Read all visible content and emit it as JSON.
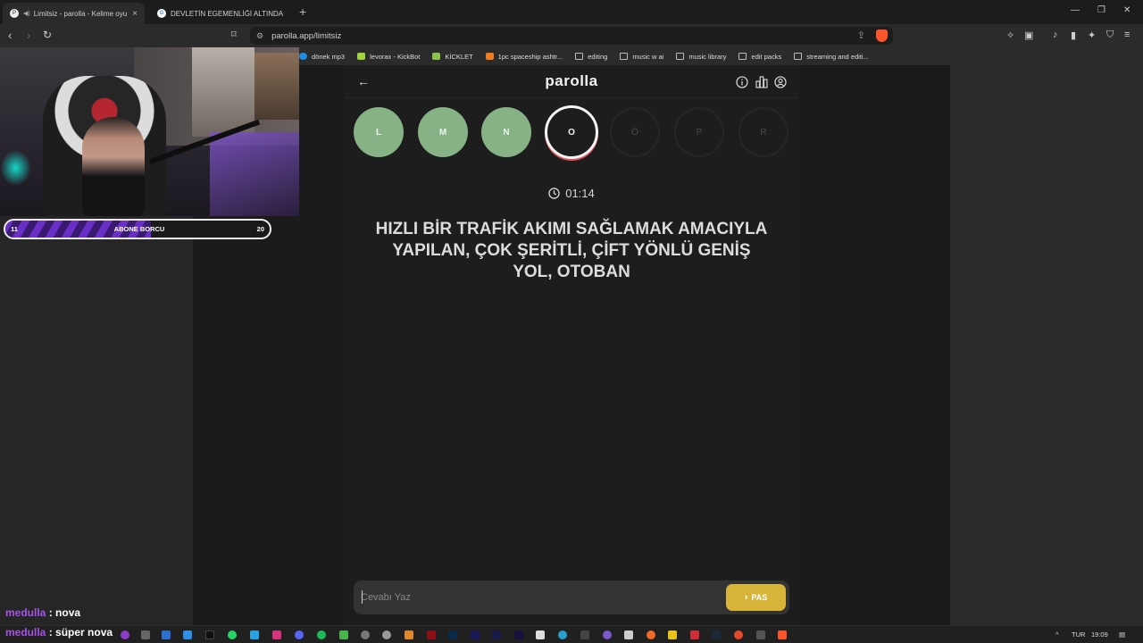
{
  "browser": {
    "tabs": [
      {
        "title": "Limitsiz - parolla - Kelime oyu",
        "active": true
      },
      {
        "title": "DEVLETİN EGEMENLİĞİ ALTINDA BU",
        "active": false
      }
    ],
    "new_tab": "+",
    "url": "parolla.app/limitsiz",
    "bookmarks": [
      {
        "label": "dönek mp3",
        "icon": "edge-icon",
        "color": "#1e8fe0"
      },
      {
        "label": "levorax - KickBot",
        "icon": "kickbot-icon",
        "color": "#9fd63a"
      },
      {
        "label": "KİCKLET",
        "icon": "kicklet-icon",
        "color": "#8bc34a"
      },
      {
        "label": "1pc spaceship ashtr...",
        "icon": "store-icon",
        "color": "#f07c1e"
      },
      {
        "label": "editing",
        "icon": "folder-icon",
        "color": "#bbbbbb"
      },
      {
        "label": "music w ai",
        "icon": "folder-icon",
        "color": "#bbbbbb"
      },
      {
        "label": "music library",
        "icon": "folder-icon",
        "color": "#bbbbbb"
      },
      {
        "label": "edit packs",
        "icon": "folder-icon",
        "color": "#bbbbbb"
      },
      {
        "label": "streaming and editi...",
        "icon": "folder-icon",
        "color": "#bbbbbb"
      }
    ]
  },
  "game": {
    "logo": "parolla",
    "letters": [
      {
        "char": "L",
        "state": "done"
      },
      {
        "char": "M",
        "state": "done"
      },
      {
        "char": "N",
        "state": "done"
      },
      {
        "char": "O",
        "state": "current"
      },
      {
        "char": "Ö",
        "state": "pending"
      },
      {
        "char": "P",
        "state": "pending"
      },
      {
        "char": "R",
        "state": "pending"
      }
    ],
    "timer": "01:14",
    "question": "HIZLI BİR TRAFİK AKIMI SAĞLAMAK AMACIYLA YAPILAN, ÇOK ŞERİTLİ, ÇİFT YÖNLÜ GENİŞ YOL, OTOBAN",
    "answer_placeholder": "Cevabı Yaz",
    "pas_label": "PAS",
    "colors": {
      "done": "#86b286",
      "pas": "#d8b43a",
      "current_ring": "#e0505a"
    }
  },
  "stream": {
    "sub_goal": {
      "left": "11",
      "label": "ABONE BORCU",
      "right": "20",
      "progress": 0.55
    },
    "chat": [
      {
        "user": "medulla",
        "sep": " : ",
        "message": "nova"
      },
      {
        "user": "medulla",
        "sep": " : ",
        "message": "süper nova"
      }
    ]
  },
  "taskbar": {
    "lang": "TUR",
    "time": "19:09"
  }
}
